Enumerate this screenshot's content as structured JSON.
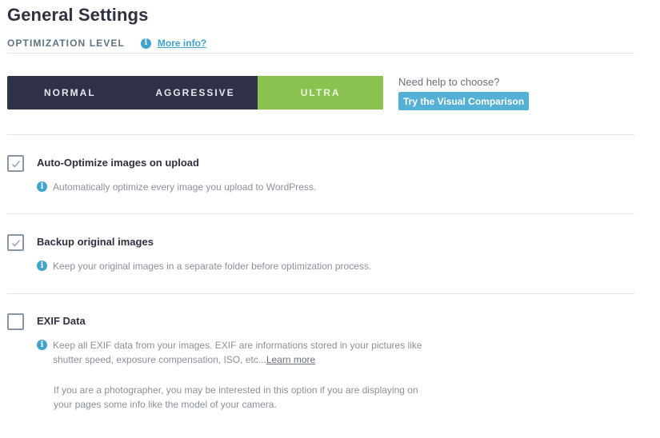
{
  "page": {
    "title": "General Settings"
  },
  "optimization": {
    "label": "OPTIMIZATION LEVEL",
    "more_info": "More info?",
    "levels": [
      {
        "label": "NORMAL",
        "active": false
      },
      {
        "label": "AGGRESSIVE",
        "active": false
      },
      {
        "label": "ULTRA",
        "active": true
      }
    ],
    "selected": "ULTRA",
    "help_text": "Need help to choose?",
    "visual_comparison_button": "Try the Visual Comparison"
  },
  "settings": [
    {
      "label": "Auto-Optimize images on upload",
      "checked": true,
      "description": "Automatically optimize every image you upload to WordPress."
    },
    {
      "label": "Backup original images",
      "checked": true,
      "description": "Keep your original images in a separate folder before optimization process."
    },
    {
      "label": "EXIF Data",
      "checked": false,
      "description_line1": "Keep all EXIF data from your images. EXIF are informations stored in your pictures like",
      "description_line2": "shutter speed, exposure compensation, ISO, etc...",
      "learn_more": "Learn more",
      "extra_line1": "If you are a photographer, you may be interested in this option if you are displaying on",
      "extra_line2": "your pages some info like the model of your camera."
    }
  ],
  "icons": {
    "info": "info-icon",
    "check": "checkmark-icon"
  },
  "colors": {
    "accent_green": "#8bc24f",
    "dark_navy": "#2e3148",
    "info_blue": "#40a4cf",
    "button_blue": "#54b0d5"
  }
}
